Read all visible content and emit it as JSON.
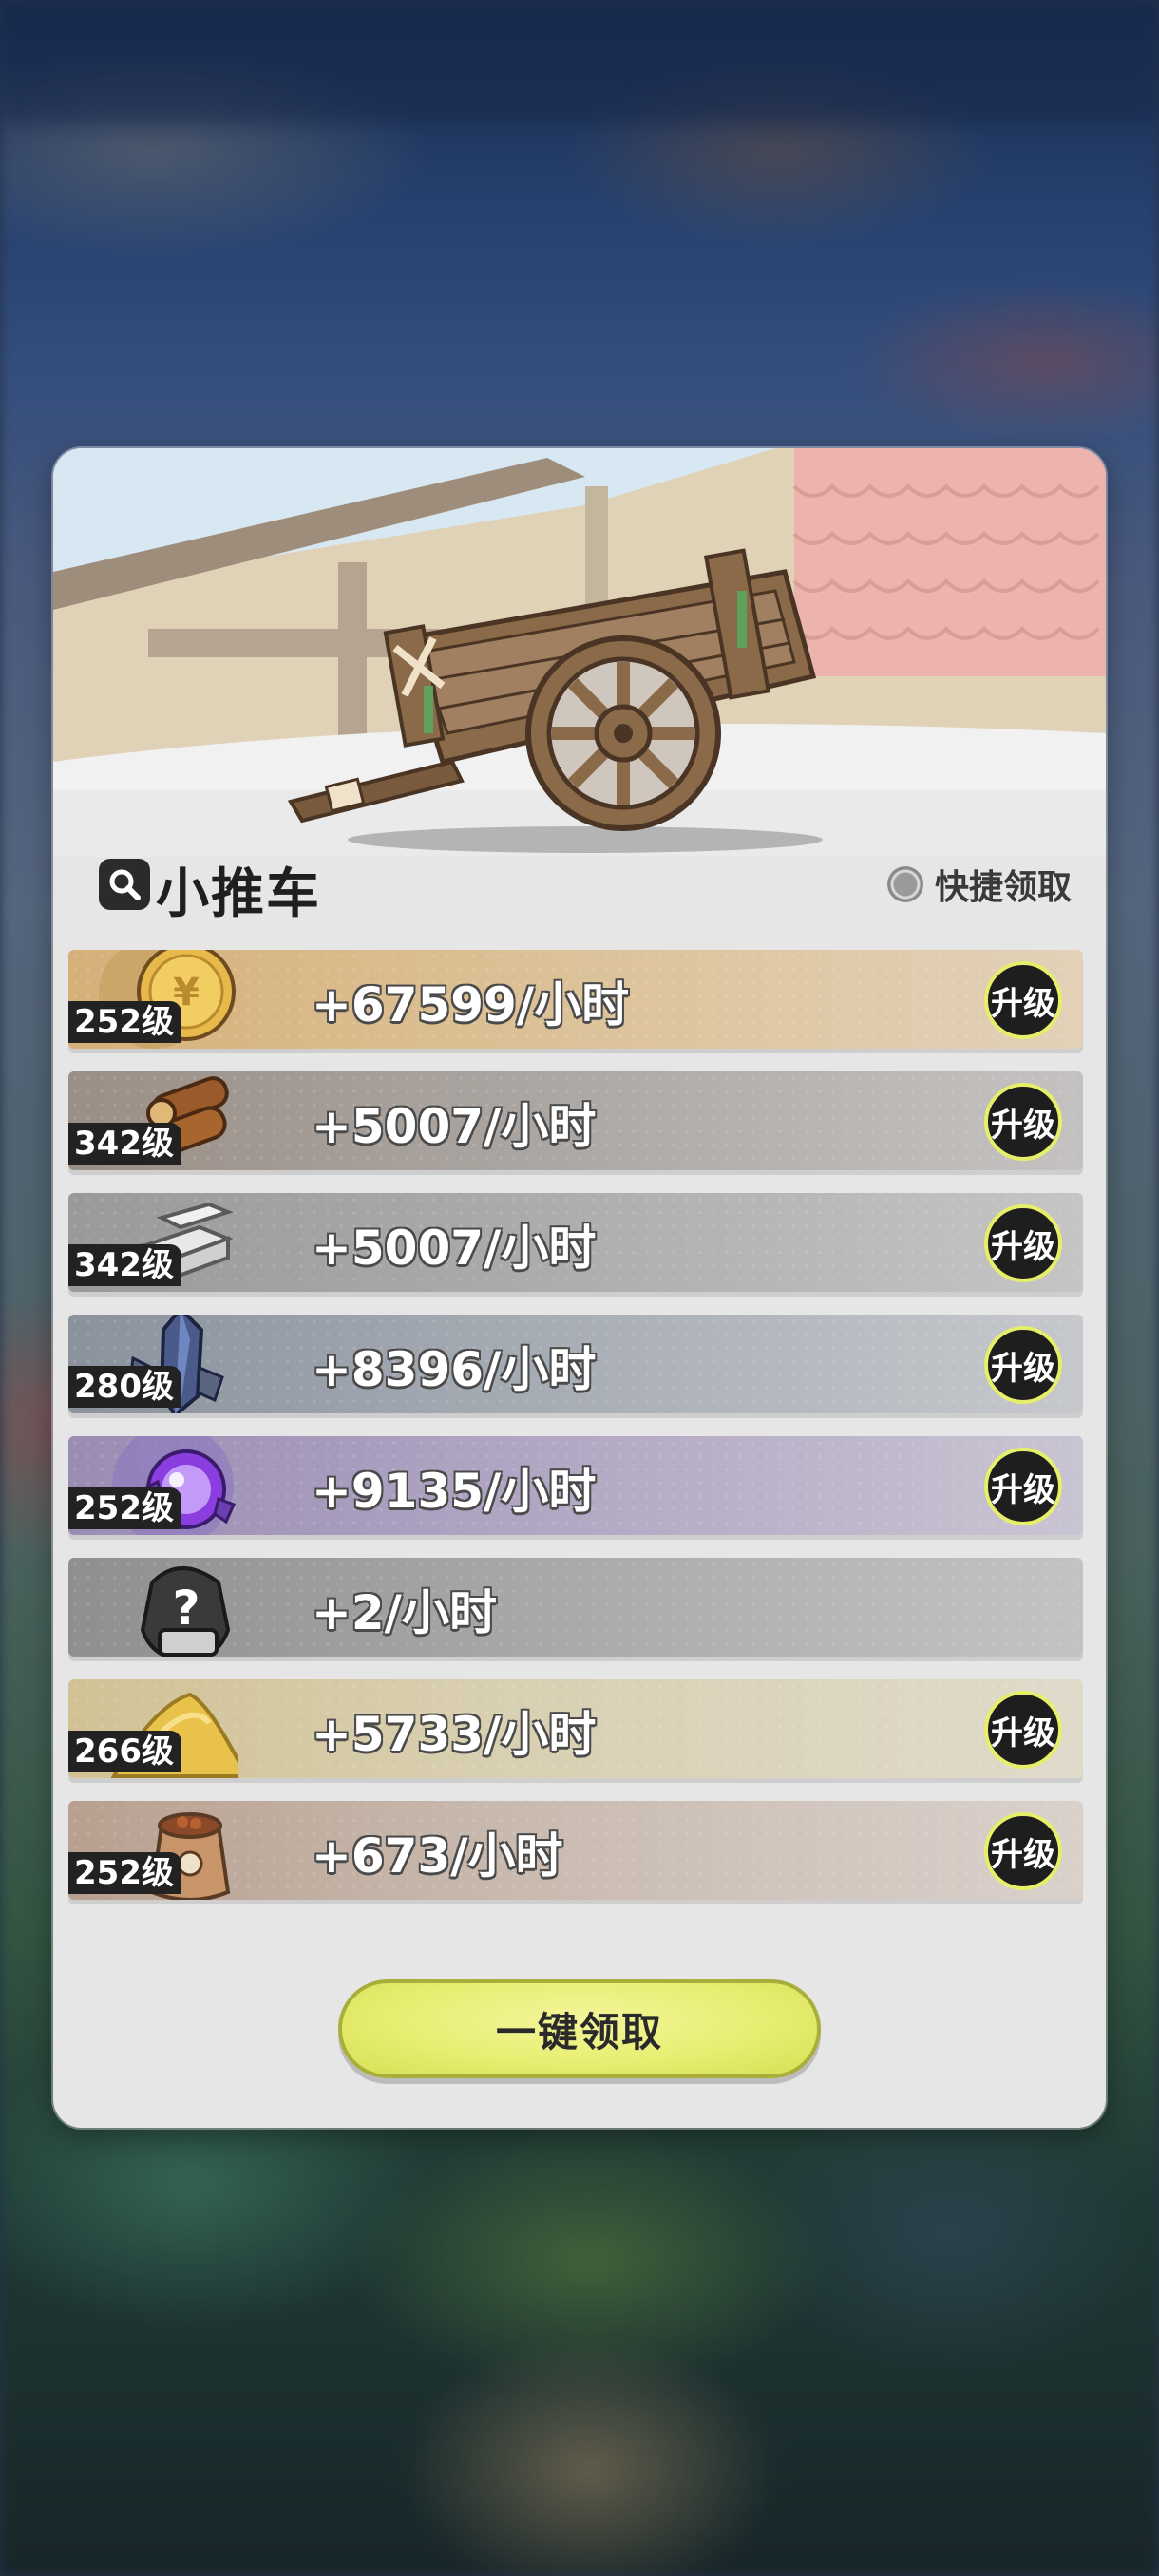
{
  "dialog": {
    "title": "小推车",
    "quick_claim_label": "快捷领取",
    "claim_all_label": "一键领取"
  },
  "rows": [
    {
      "resource": "gold-coin",
      "level": "252级",
      "amount": "+67599/小时",
      "upgrade_label": "升级"
    },
    {
      "resource": "wood-logs",
      "level": "342级",
      "amount": "+5007/小时",
      "upgrade_label": "升级"
    },
    {
      "resource": "stone-bricks",
      "level": "342级",
      "amount": "+5007/小时",
      "upgrade_label": "升级"
    },
    {
      "resource": "crystal-ore",
      "level": "280级",
      "amount": "+8396/小时",
      "upgrade_label": "升级"
    },
    {
      "resource": "purple-orb",
      "level": "252级",
      "amount": "+9135/小时",
      "upgrade_label": "升级"
    },
    {
      "resource": "mystery-item",
      "level": "",
      "amount": "+2/小时",
      "upgrade_label": ""
    },
    {
      "resource": "gold-sand",
      "level": "266级",
      "amount": "+5733/小时",
      "upgrade_label": "升级"
    },
    {
      "resource": "food-sack",
      "level": "252级",
      "amount": "+673/小时",
      "upgrade_label": "升级"
    }
  ],
  "colors": {
    "dialog_bg": "#e6e6e6",
    "accent_yellow": "#e8ee72",
    "level_badge_bg": "#222222"
  }
}
